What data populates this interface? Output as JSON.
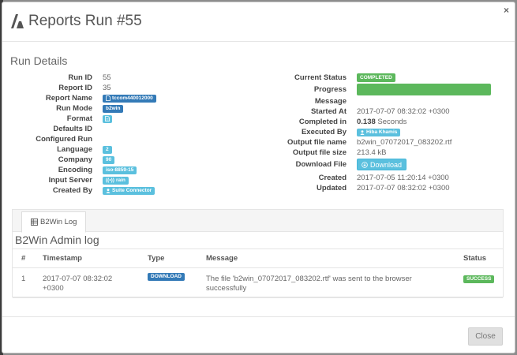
{
  "dialog": {
    "title": "Reports Run #55",
    "close_glyph": "×",
    "logo": "app-logo-icon"
  },
  "section_title": "Run Details",
  "details_left": {
    "run_id": {
      "label": "Run ID",
      "value": "55"
    },
    "report_id": {
      "label": "Report ID",
      "value": "35"
    },
    "report_name": {
      "label": "Report Name",
      "value": "tccom440012000"
    },
    "run_mode": {
      "label": "Run Mode",
      "value": "b2win"
    },
    "format": {
      "label": "Format",
      "icon": "file-icon"
    },
    "defaults_id": {
      "label": "Defaults ID",
      "value": ""
    },
    "configured_run": {
      "label": "Configured Run",
      "value": ""
    },
    "language": {
      "label": "Language",
      "value": "2"
    },
    "company": {
      "label": "Company",
      "value": "90"
    },
    "encoding": {
      "label": "Encoding",
      "value": "iso-8859-15"
    },
    "input_server": {
      "label": "Input Server",
      "value": "rain"
    },
    "created_by": {
      "label": "Created By",
      "value": "Suite Connector"
    }
  },
  "details_right": {
    "current_status": {
      "label": "Current Status",
      "value": "COMPLETED"
    },
    "progress": {
      "label": "Progress",
      "percent": 100
    },
    "message": {
      "label": "Message",
      "value": ""
    },
    "started_at": {
      "label": "Started At",
      "value": "2017-07-07 08:32:02 +0300"
    },
    "completed_in": {
      "label": "Completed in",
      "value_bold": "0.138",
      "value_rest": " Seconds"
    },
    "executed_by": {
      "label": "Executed By",
      "value": "Hiba Khamis"
    },
    "output_file_name": {
      "label": "Output file name",
      "value": "b2win_07072017_083202.rtf"
    },
    "output_file_size": {
      "label": "Output file size",
      "value": "213.4 kB"
    },
    "download_file": {
      "label": "Download File",
      "button": "Download"
    },
    "created": {
      "label": "Created",
      "value": "2017-07-05 11:20:14 +0300"
    },
    "updated": {
      "label": "Updated",
      "value": "2017-07-07 08:32:02 +0300"
    }
  },
  "tabs": [
    {
      "label": "B2Win Log",
      "icon": "table-icon"
    }
  ],
  "log": {
    "title": "B2Win Admin log",
    "columns": [
      "#",
      "Timestamp",
      "Type",
      "Message",
      "Status"
    ],
    "rows": [
      {
        "num": "1",
        "timestamp_line1": "2017-07-07 08:32:02",
        "timestamp_line2": "+0300",
        "type": "DOWNLOAD",
        "message_line1": "The file 'b2win_07072017_083202.rtf' was sent to the browser",
        "message_line2": "successfully",
        "status": "SUCCESS"
      }
    ]
  },
  "footer": {
    "close_label": "Close"
  },
  "colors": {
    "primary": "#337ab7",
    "info": "#5bc0de",
    "success": "#5cb85c"
  }
}
